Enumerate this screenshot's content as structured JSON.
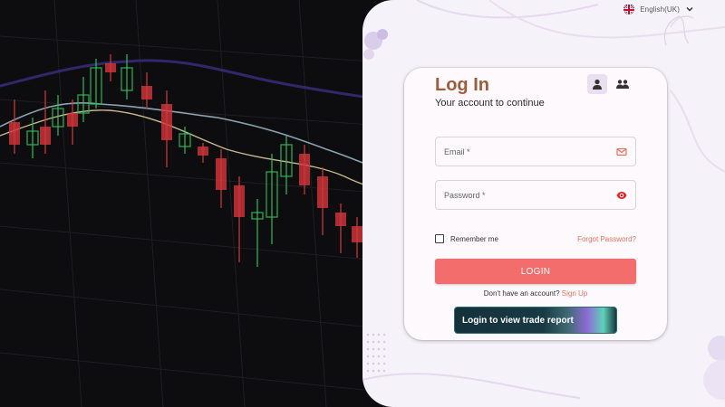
{
  "language": {
    "label": "English(UK)",
    "flag_icon": "uk-flag-icon",
    "dropdown_icon": "chevron-down-icon"
  },
  "card": {
    "title": "Log In",
    "subtitle": "Your account to continue",
    "role_toggle": [
      {
        "icon": "single-user-icon",
        "active": true
      },
      {
        "icon": "multi-user-icon",
        "active": false
      }
    ],
    "email": {
      "placeholder": "Email *",
      "value": "",
      "icon": "mail-icon"
    },
    "password": {
      "placeholder": "Password *",
      "value": "",
      "icon": "eye-icon"
    },
    "remember_label": "Remember me",
    "remember_checked": false,
    "forgot_label": "Forgot Password?",
    "login_label": "LOGIN",
    "signup_prompt": "Don't have an account?",
    "signup_link": "Sign Up",
    "trade_report_label": "Login to view trade report"
  },
  "colors": {
    "accent": "#f26d6b",
    "link": "#e9715e",
    "title": "#9b5e3c",
    "panel_bg": "#f6f2f9",
    "chart_bg": "#0d0d0f"
  }
}
